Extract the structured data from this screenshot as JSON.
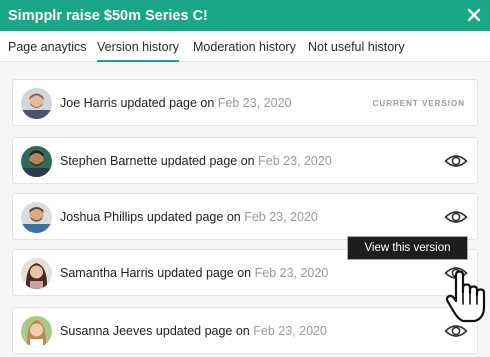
{
  "header": {
    "title": "Simpplr raise $50m Series C!",
    "close_icon": "close-icon",
    "accent_color": "#1aa689"
  },
  "tabs": [
    {
      "label": "Page anaytics",
      "active": false
    },
    {
      "label": "Version history",
      "active": true
    },
    {
      "label": "Moderation history",
      "active": false
    },
    {
      "label": "Not useful history",
      "active": false
    }
  ],
  "versions": [
    {
      "name": "Joe Harris",
      "action": "updated page on",
      "date": "Feb 23, 2020",
      "badge": "CURRENT VERSION"
    },
    {
      "name": "Stephen Barnette",
      "action": "updated page on",
      "date": "Feb 23, 2020",
      "icon": "eye-icon"
    },
    {
      "name": "Joshua Phillips",
      "action": "updated page on",
      "date": "Feb 23, 2020",
      "icon": "eye-icon"
    },
    {
      "name": "Samantha Harris",
      "action": "updated page on",
      "date": "Feb 23, 2020",
      "icon": "eye-icon"
    },
    {
      "name": "Susanna Jeeves",
      "action": "updated page on",
      "date": "Feb 23, 2020",
      "icon": "eye-icon"
    }
  ],
  "tooltip": {
    "text": "View this version"
  },
  "cursor": {
    "icon": "hand-pointer-icon"
  }
}
